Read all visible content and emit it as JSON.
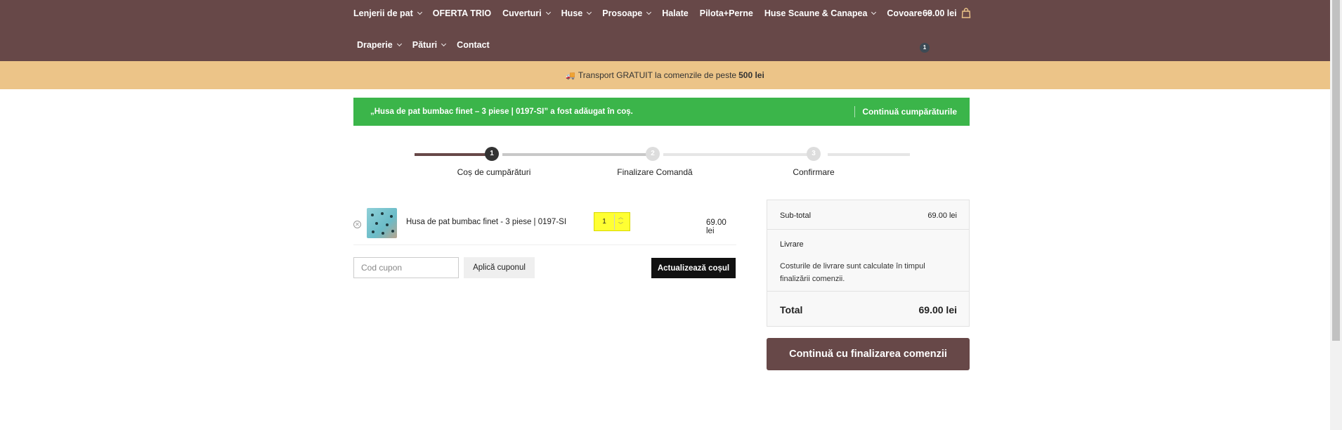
{
  "nav": {
    "row1": [
      {
        "label": "Lenjerii de pat",
        "dropdown": true
      },
      {
        "label": "OFERTA TRIO",
        "dropdown": false
      },
      {
        "label": "Cuverturi",
        "dropdown": true
      },
      {
        "label": "Huse",
        "dropdown": true
      },
      {
        "label": "Prosoape",
        "dropdown": true
      },
      {
        "label": "Halate",
        "dropdown": false
      },
      {
        "label": "Pilota+Perne",
        "dropdown": false
      },
      {
        "label": "Huse Scaune & Canapea",
        "dropdown": true
      },
      {
        "label": "Covoare",
        "dropdown": true
      }
    ],
    "row2": [
      {
        "label": "Draperie",
        "dropdown": true
      },
      {
        "label": "Pături",
        "dropdown": true
      },
      {
        "label": "Contact",
        "dropdown": false
      }
    ],
    "cart_total": "69.00 lei",
    "cart_count": "1",
    "cart_icon": "shopping-bag-icon"
  },
  "promo": {
    "icon": "truck-icon",
    "text": "Transport GRATUIT la comenzile de peste",
    "amount": "500 lei"
  },
  "notice": {
    "message": "„Husa de pat bumbac finet – 3 piese | 0197-SI” a fost adăugat în coș.",
    "button": "Continuă cumpărăturile",
    "color": "#3bb54a"
  },
  "steps": [
    {
      "number": "1",
      "label": "Coș de cumpărături",
      "active": true
    },
    {
      "number": "2",
      "label": "Finalizare Comandă",
      "active": false
    },
    {
      "number": "3",
      "label": "Confirmare",
      "active": false
    }
  ],
  "cart": {
    "items": [
      {
        "name": "Husa de pat bumbac finet - 3 piese | 0197-SI",
        "quantity": "1",
        "price": "69.00 lei"
      }
    ],
    "coupon_placeholder": "Cod cupon",
    "apply_coupon": "Aplică cuponul",
    "update_cart": "Actualizează coșul"
  },
  "totals": {
    "subtotal_label": "Sub-total",
    "subtotal_value": "69.00 lei",
    "shipping_label": "Livrare",
    "shipping_note": "Costurile de livrare sunt calculate în timpul finalizării comenzii.",
    "total_label": "Total",
    "total_value": "69.00 lei",
    "checkout_button": "Continuă cu finalizarea comenzii"
  },
  "colors": {
    "header": "#674848",
    "promo": "#ecc488",
    "checkout": "#674848",
    "highlight": "#ffff33"
  }
}
